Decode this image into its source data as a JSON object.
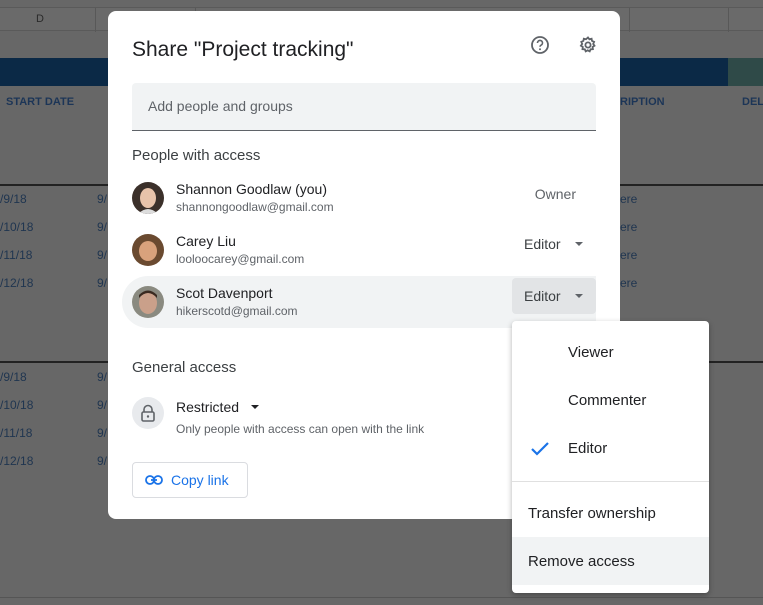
{
  "spreadsheet": {
    "column_letter": "D",
    "headers": {
      "start_date": "START DATE",
      "description": "RIPTION",
      "deliverable": "DEL"
    },
    "date_rows_a": [
      "/9/18",
      "/10/18",
      "/11/18",
      "/12/18"
    ],
    "date_rows_b": [
      "/9/18",
      "/10/18",
      "/11/18",
      "/12/18"
    ],
    "end_col_fragment": "9/",
    "desc_fragment": "ere"
  },
  "dialog": {
    "title": "Share \"Project tracking\"",
    "help_icon": "help-circle-icon",
    "settings_icon": "gear-icon",
    "add_placeholder": "Add people and groups",
    "people_section": "People with access",
    "people": [
      {
        "name": "Shannon Goodlaw (you)",
        "email": "shannongoodlaw@gmail.com",
        "role": "Owner"
      },
      {
        "name": "Carey Liu",
        "email": "looloocarey@gmail.com",
        "role": "Editor"
      },
      {
        "name": "Scot Davenport",
        "email": "hikerscotd@gmail.com",
        "role": "Editor"
      }
    ],
    "general_section": "General access",
    "general": {
      "level": "Restricted",
      "description": "Only people with access can open with the link"
    },
    "copy_link": "Copy link"
  },
  "role_menu": {
    "options": [
      "Viewer",
      "Commenter",
      "Editor"
    ],
    "selected": "Editor",
    "actions": [
      "Transfer ownership",
      "Remove access"
    ],
    "accent": "#1a73e8"
  }
}
